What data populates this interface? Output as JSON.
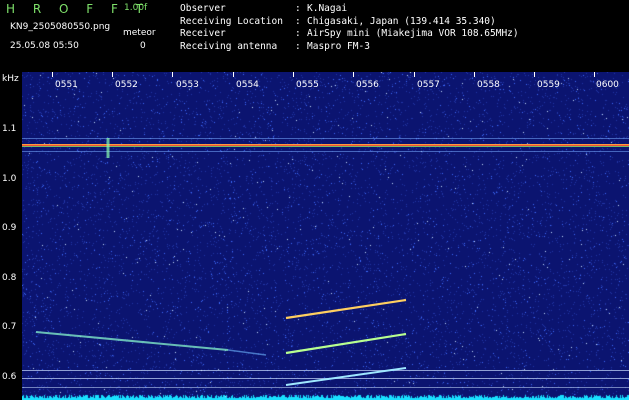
{
  "header": {
    "app_title": "H R O F F T",
    "version": "1.00f",
    "filename": "KN9_2505080550.png",
    "meteor_label": "meteor",
    "datetime": "25.05.08 05:50",
    "meteor_count": "0"
  },
  "info": [
    {
      "key": "Observer",
      "value": "K.Nagai"
    },
    {
      "key": "Receiving Location",
      "value": "Chigasaki, Japan (139.414 35.340)"
    },
    {
      "key": "Receiver",
      "value": "AirSpy mini (Miakejima VOR 108.65MHz)"
    },
    {
      "key": "Receiving antenna",
      "value": "Maspro FM-3"
    }
  ],
  "y_unit": "kHz",
  "y_ticks": [
    "1.1",
    "1.0",
    "0.9",
    "0.8",
    "0.7",
    "0.6"
  ],
  "time_ticks": [
    "0551",
    "0552",
    "0553",
    "0554",
    "0555",
    "0556",
    "0557",
    "0558",
    "0559",
    "0600"
  ],
  "colors": {
    "background": "#0b1470",
    "carrier": "#ff3b3b",
    "trace": "#9fffb0",
    "floor": "#19e0ff"
  }
}
